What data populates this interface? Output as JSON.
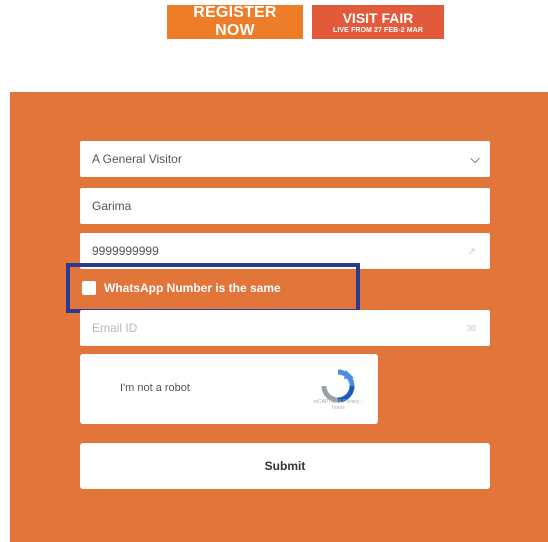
{
  "header": {
    "register_label": "REGISTER NOW",
    "visit_label": "VISIT FAIR",
    "visit_sub": "LIVE FROM 27 FEB-2 MAR"
  },
  "form": {
    "visitor_type": "A General Visitor",
    "name_value": "Garima",
    "phone_value": "9999999999",
    "whatsapp_label": "WhatsApp Number is the same",
    "email_placeholder": "Email ID",
    "recaptcha_label": "I'm not a robot",
    "recaptcha_privacy": "reCAPTCHA Privacy - Terms",
    "submit_label": "Submit"
  },
  "colors": {
    "panel": "#e2763a",
    "register_button": "#ee7d2a",
    "visit_button": "#e25a3a",
    "highlight_border": "#2a3b8f"
  }
}
